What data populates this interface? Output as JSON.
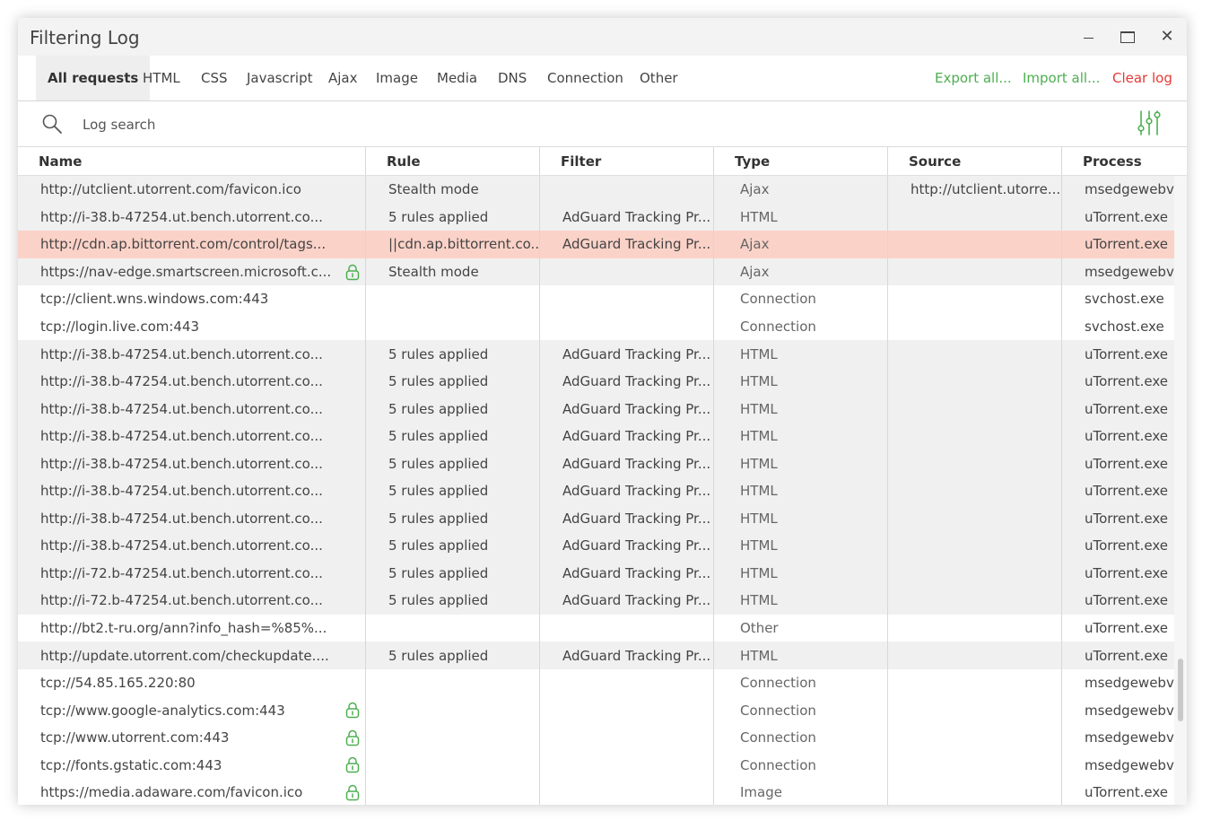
{
  "window": {
    "title": "Filtering Log"
  },
  "tabs": [
    "All requests",
    "HTML",
    "CSS",
    "Javascript",
    "Ajax",
    "Image",
    "Media",
    "DNS",
    "Connection",
    "Other"
  ],
  "actions": [
    {
      "label": "Export all...",
      "color": "#4caf50"
    },
    {
      "label": "Import all...",
      "color": "#4caf50"
    },
    {
      "label": "Clear log",
      "color": "#e53935"
    }
  ],
  "search": {
    "placeholder": "Log search"
  },
  "columns": [
    "Name",
    "Rule",
    "Filter",
    "Type",
    "Source",
    "Process"
  ],
  "colors": {
    "accent": "#4caf50",
    "danger": "#e53935",
    "blocked_row": "#fbd2c8"
  },
  "rows": [
    {
      "name": "http://utclient.utorrent.com/favicon.ico",
      "rule": "Stealth mode",
      "filter": "",
      "type": "Ajax",
      "source": "http://utclient.utorre...",
      "process": "msedgewebv...",
      "bg": "grey",
      "lock": false
    },
    {
      "name": "http://i-38.b-47254.ut.bench.utorrent.co...",
      "rule": "5 rules applied",
      "filter": "AdGuard Tracking Pr...",
      "type": "HTML",
      "source": "",
      "process": "uTorrent.exe",
      "bg": "grey",
      "lock": false
    },
    {
      "name": "http://cdn.ap.bittorrent.com/control/tags...",
      "rule": "||cdn.ap.bittorrent.co...",
      "filter": "AdGuard Tracking Pr...",
      "type": "Ajax",
      "source": "",
      "process": "uTorrent.exe",
      "bg": "blocked",
      "lock": false
    },
    {
      "name": "https://nav-edge.smartscreen.microsoft.c...",
      "rule": "Stealth mode",
      "filter": "",
      "type": "Ajax",
      "source": "",
      "process": "msedgewebv...",
      "bg": "grey",
      "lock": true
    },
    {
      "name": "tcp://client.wns.windows.com:443",
      "rule": "",
      "filter": "",
      "type": "Connection",
      "source": "",
      "process": "svchost.exe",
      "bg": "white",
      "lock": false
    },
    {
      "name": "tcp://login.live.com:443",
      "rule": "",
      "filter": "",
      "type": "Connection",
      "source": "",
      "process": "svchost.exe",
      "bg": "white",
      "lock": false
    },
    {
      "name": "http://i-38.b-47254.ut.bench.utorrent.co...",
      "rule": "5 rules applied",
      "filter": "AdGuard Tracking Pr...",
      "type": "HTML",
      "source": "",
      "process": "uTorrent.exe",
      "bg": "grey",
      "lock": false
    },
    {
      "name": "http://i-38.b-47254.ut.bench.utorrent.co...",
      "rule": "5 rules applied",
      "filter": "AdGuard Tracking Pr...",
      "type": "HTML",
      "source": "",
      "process": "uTorrent.exe",
      "bg": "grey",
      "lock": false
    },
    {
      "name": "http://i-38.b-47254.ut.bench.utorrent.co...",
      "rule": "5 rules applied",
      "filter": "AdGuard Tracking Pr...",
      "type": "HTML",
      "source": "",
      "process": "uTorrent.exe",
      "bg": "grey",
      "lock": false
    },
    {
      "name": "http://i-38.b-47254.ut.bench.utorrent.co...",
      "rule": "5 rules applied",
      "filter": "AdGuard Tracking Pr...",
      "type": "HTML",
      "source": "",
      "process": "uTorrent.exe",
      "bg": "grey",
      "lock": false
    },
    {
      "name": "http://i-38.b-47254.ut.bench.utorrent.co...",
      "rule": "5 rules applied",
      "filter": "AdGuard Tracking Pr...",
      "type": "HTML",
      "source": "",
      "process": "uTorrent.exe",
      "bg": "grey",
      "lock": false
    },
    {
      "name": "http://i-38.b-47254.ut.bench.utorrent.co...",
      "rule": "5 rules applied",
      "filter": "AdGuard Tracking Pr...",
      "type": "HTML",
      "source": "",
      "process": "uTorrent.exe",
      "bg": "grey",
      "lock": false
    },
    {
      "name": "http://i-38.b-47254.ut.bench.utorrent.co...",
      "rule": "5 rules applied",
      "filter": "AdGuard Tracking Pr...",
      "type": "HTML",
      "source": "",
      "process": "uTorrent.exe",
      "bg": "grey",
      "lock": false
    },
    {
      "name": "http://i-38.b-47254.ut.bench.utorrent.co...",
      "rule": "5 rules applied",
      "filter": "AdGuard Tracking Pr...",
      "type": "HTML",
      "source": "",
      "process": "uTorrent.exe",
      "bg": "grey",
      "lock": false
    },
    {
      "name": "http://i-72.b-47254.ut.bench.utorrent.co...",
      "rule": "5 rules applied",
      "filter": "AdGuard Tracking Pr...",
      "type": "HTML",
      "source": "",
      "process": "uTorrent.exe",
      "bg": "grey",
      "lock": false
    },
    {
      "name": "http://i-72.b-47254.ut.bench.utorrent.co...",
      "rule": "5 rules applied",
      "filter": "AdGuard Tracking Pr...",
      "type": "HTML",
      "source": "",
      "process": "uTorrent.exe",
      "bg": "grey",
      "lock": false
    },
    {
      "name": "http://bt2.t-ru.org/ann?info_hash=%85%...",
      "rule": "",
      "filter": "",
      "type": "Other",
      "source": "",
      "process": "uTorrent.exe",
      "bg": "white",
      "lock": false
    },
    {
      "name": "http://update.utorrent.com/checkupdate....",
      "rule": "5 rules applied",
      "filter": "AdGuard Tracking Pr...",
      "type": "HTML",
      "source": "",
      "process": "uTorrent.exe",
      "bg": "grey",
      "lock": false
    },
    {
      "name": "tcp://54.85.165.220:80",
      "rule": "",
      "filter": "",
      "type": "Connection",
      "source": "",
      "process": "msedgewebv...",
      "bg": "white",
      "lock": false
    },
    {
      "name": "tcp://www.google-analytics.com:443",
      "rule": "",
      "filter": "",
      "type": "Connection",
      "source": "",
      "process": "msedgewebv...",
      "bg": "white",
      "lock": true
    },
    {
      "name": "tcp://www.utorrent.com:443",
      "rule": "",
      "filter": "",
      "type": "Connection",
      "source": "",
      "process": "msedgewebv...",
      "bg": "white",
      "lock": true
    },
    {
      "name": "tcp://fonts.gstatic.com:443",
      "rule": "",
      "filter": "",
      "type": "Connection",
      "source": "",
      "process": "msedgewebv...",
      "bg": "white",
      "lock": true
    },
    {
      "name": "https://media.adaware.com/favicon.ico",
      "rule": "",
      "filter": "",
      "type": "Image",
      "source": "",
      "process": "uTorrent.exe",
      "bg": "white",
      "lock": true
    }
  ]
}
